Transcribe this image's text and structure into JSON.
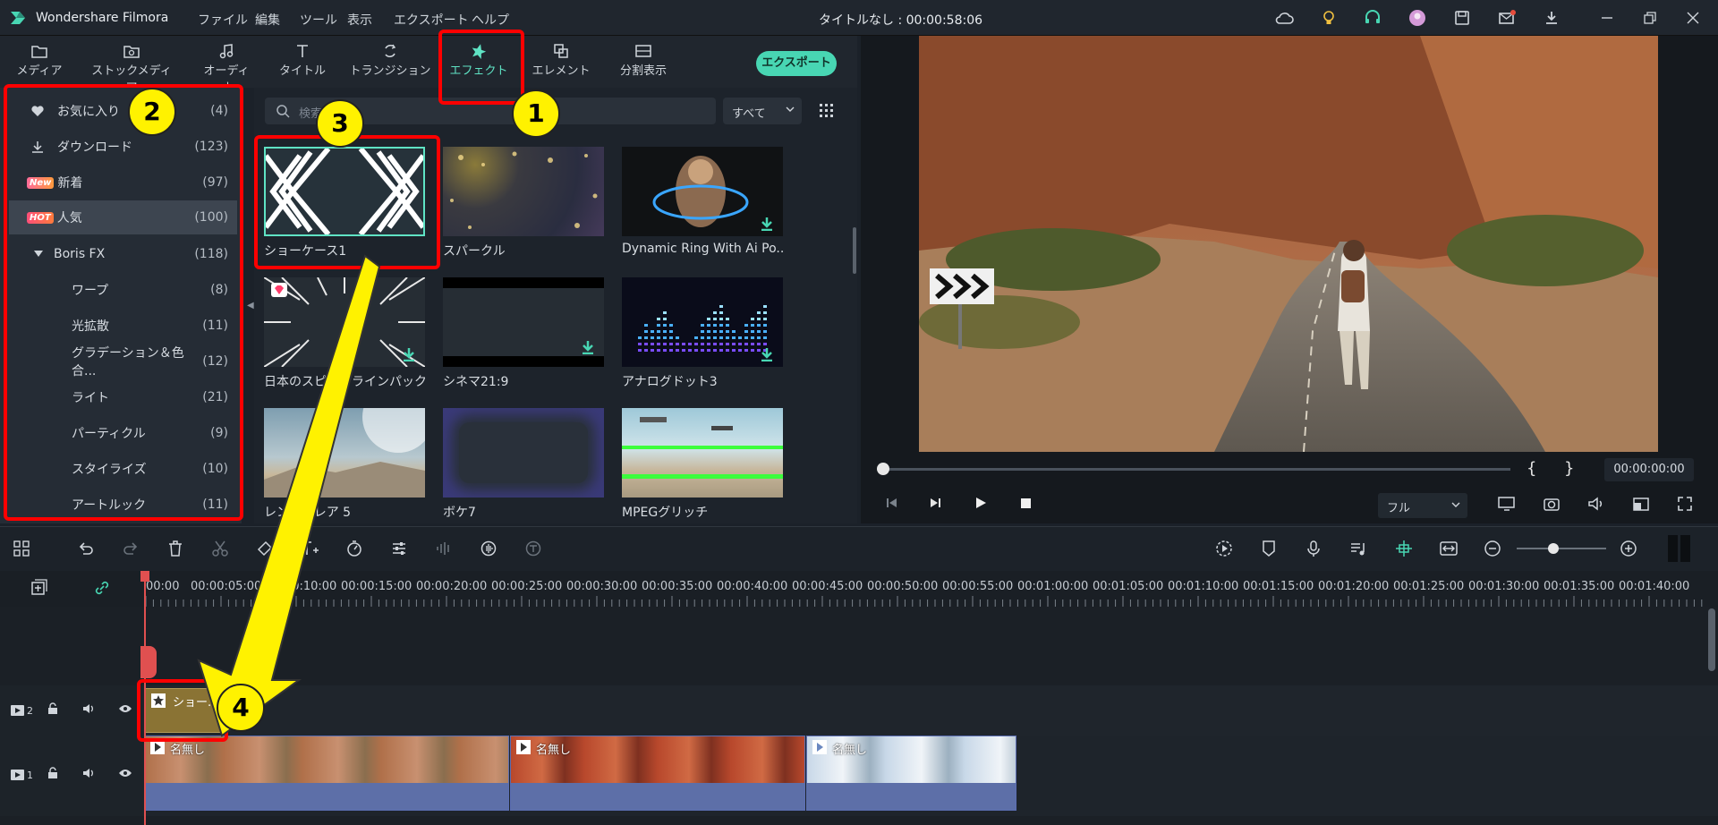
{
  "app": {
    "name": "Wondershare Filmora",
    "title": "タイトルなし : 00:00:58:06"
  },
  "menu": [
    "ファイル",
    "編集",
    "ツール",
    "表示",
    "エクスポート",
    "ヘルプ"
  ],
  "toolbar": {
    "tabs": [
      "メディア",
      "ストックメディア",
      "オーディオ",
      "タイトル",
      "トランジション",
      "エフェクト",
      "エレメント",
      "分割表示"
    ],
    "export_label": "エクスポート"
  },
  "sidebar": {
    "items": [
      {
        "label": "お気に入り",
        "count": "(4)"
      },
      {
        "label": "ダウンロード",
        "count": "(123)"
      },
      {
        "label": "新着",
        "count": "(97)",
        "badge": "New"
      },
      {
        "label": "人気",
        "count": "(100)",
        "badge": "HOT"
      },
      {
        "label": "Boris FX",
        "count": "(118)"
      },
      {
        "label": "ワープ",
        "count": "(8)"
      },
      {
        "label": "光拡散",
        "count": "(11)"
      },
      {
        "label": "グラデーション＆色合...",
        "count": "(12)"
      },
      {
        "label": "ライト",
        "count": "(21)"
      },
      {
        "label": "パーティクル",
        "count": "(9)"
      },
      {
        "label": "スタイライズ",
        "count": "(10)"
      },
      {
        "label": "アートルック",
        "count": "(11)"
      }
    ]
  },
  "search": {
    "placeholder": "検索",
    "filter": "すべて"
  },
  "effects": [
    {
      "name": "ショーケース1"
    },
    {
      "name": "スパークル"
    },
    {
      "name": "Dynamic Ring With Ai Po..."
    },
    {
      "name": "日本のスピードラインパック オ..."
    },
    {
      "name": "シネマ21:9"
    },
    {
      "name": "アナログドット3"
    },
    {
      "name": "レンズフレア 5"
    },
    {
      "name": "ボケ7"
    },
    {
      "name": "MPEGグリッチ"
    }
  ],
  "preview": {
    "timecode": "00:00:00:00",
    "zoom": "フル",
    "bracket_in": "{",
    "bracket_out": "}"
  },
  "timeline": {
    "ruler": [
      "00:00",
      "00:00:05:00",
      "00:00:10:00",
      "00:00:15:00",
      "00:00:20:00",
      "00:00:25:00",
      "00:00:30:00",
      "00:00:35:00",
      "00:00:40:00",
      "00:00:45:00",
      "00:00:50:00",
      "00:00:55:00",
      "00:01:00:00",
      "00:01:05:00",
      "00:01:10:00",
      "00:01:15:00",
      "00:01:20:00",
      "00:01:25:00",
      "00:01:30:00",
      "00:01:35:00",
      "00:01:40:00"
    ],
    "track2_num": "2",
    "track1_num": "1",
    "effect_clip": "ショー...",
    "video_clips": [
      "名無し",
      "名無し",
      "名無し"
    ]
  },
  "annotations": {
    "numbers": [
      "1",
      "2",
      "3",
      "4"
    ],
    "highlight_color": "#ff0000",
    "marker_color": "#fff200"
  },
  "colors": {
    "accent": "#48d6b3",
    "active_tab": "#5fe3c4",
    "effect_clip": "#8a7334",
    "video_track": "#5d6fa8"
  }
}
